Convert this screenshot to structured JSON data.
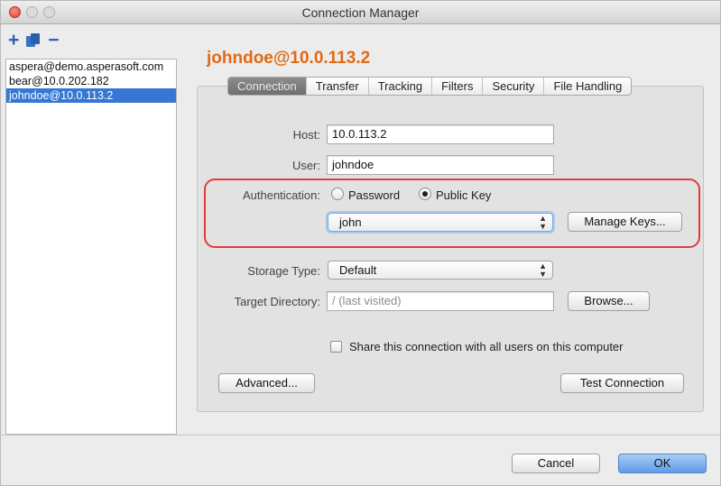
{
  "window": {
    "title": "Connection Manager"
  },
  "sidebar": {
    "toolbar": {
      "add": "+",
      "remove": "−"
    },
    "connections": [
      {
        "label": "aspera@demo.asperasoft.com",
        "selected": false
      },
      {
        "label": "bear@10.0.202.182",
        "selected": false
      },
      {
        "label": "johndoe@10.0.113.2",
        "selected": true
      }
    ]
  },
  "main": {
    "connection_title": "johndoe@10.0.113.2",
    "tabs": [
      {
        "label": "Connection",
        "active": true
      },
      {
        "label": "Transfer",
        "active": false
      },
      {
        "label": "Tracking",
        "active": false
      },
      {
        "label": "Filters",
        "active": false
      },
      {
        "label": "Security",
        "active": false
      },
      {
        "label": "File Handling",
        "active": false
      }
    ],
    "host": {
      "label": "Host:",
      "value": "10.0.113.2"
    },
    "user": {
      "label": "User:",
      "value": "johndoe"
    },
    "authentication": {
      "label": "Authentication:",
      "options": [
        "Password",
        "Public Key"
      ],
      "selected": "Public Key",
      "key_select": "john",
      "manage_keys_label": "Manage Keys..."
    },
    "storage_type": {
      "label": "Storage Type:",
      "value": "Default"
    },
    "target_directory": {
      "label": "Target Directory:",
      "placeholder": "/ (last visited)",
      "browse_label": "Browse..."
    },
    "share": {
      "label": "Share this connection with all users on this computer",
      "checked": false
    },
    "advanced_label": "Advanced...",
    "test_connection_label": "Test Connection"
  },
  "footer": {
    "cancel_label": "Cancel",
    "ok_label": "OK"
  },
  "colors": {
    "accent": "#e06a15",
    "selection": "#3577d3",
    "highlight": "#e23b3b"
  }
}
